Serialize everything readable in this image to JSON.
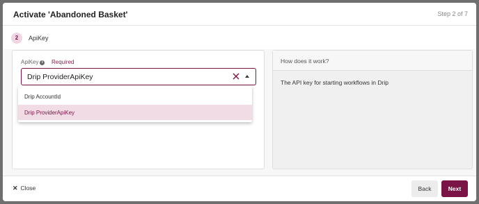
{
  "header": {
    "title": "Activate 'Abandoned Basket'",
    "step_text": "Step 2 of 7"
  },
  "step": {
    "number": "2",
    "label": "ApiKey"
  },
  "field": {
    "label": "ApiKey",
    "info_icon_glyph": "i",
    "required_text": "Required",
    "selected_value": "Drip ProviderApiKey",
    "options": [
      "Drip AccountId",
      "Drip ProviderApiKey"
    ]
  },
  "help": {
    "title": "How does it work?",
    "body": "The API key for starting workflows in Drip"
  },
  "footer": {
    "close_label": "Close",
    "close_icon": "✕",
    "back_label": "Back",
    "next_label": "Next"
  },
  "colors": {
    "accent": "#7a1446",
    "selected_option_bg": "#f1dbe4"
  }
}
